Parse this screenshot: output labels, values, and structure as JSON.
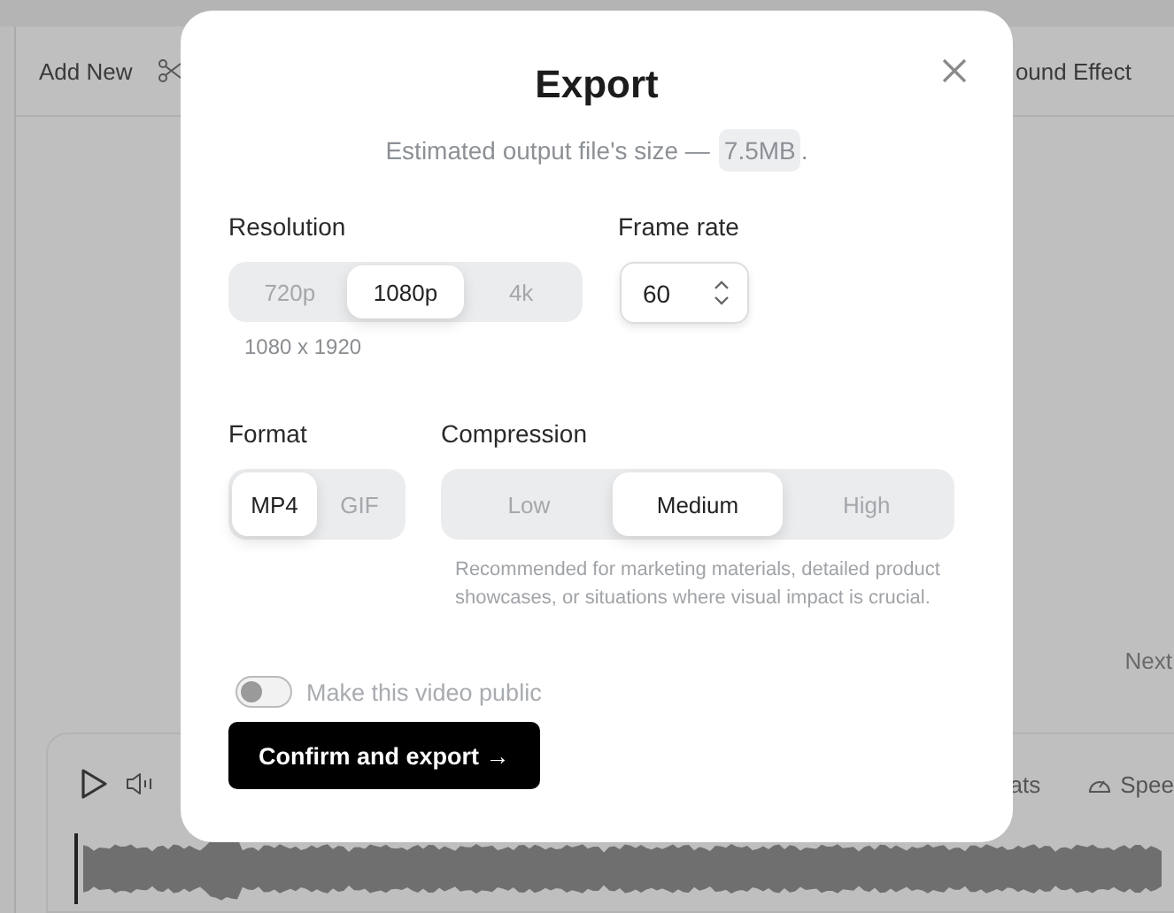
{
  "background": {
    "toolbar": {
      "add_new": "Add New",
      "sound_effect": "ound Effect"
    },
    "next": "Next",
    "player": {
      "beats": "ats",
      "speed": "Spee"
    }
  },
  "dialog": {
    "title": "Export",
    "subtitle": "Estimated output file's size —",
    "size": "7.5MB",
    "subtitle_end": ".",
    "resolution": {
      "label": "Resolution",
      "options": [
        {
          "label": "720p",
          "selected": false
        },
        {
          "label": "1080p",
          "selected": true
        },
        {
          "label": "4k",
          "selected": false
        }
      ],
      "caption": "1080 x 1920"
    },
    "frame_rate": {
      "label": "Frame rate",
      "value": "60"
    },
    "format": {
      "label": "Format",
      "options": [
        {
          "label": "MP4",
          "selected": true
        },
        {
          "label": "GIF",
          "selected": false
        }
      ]
    },
    "compression": {
      "label": "Compression",
      "options": [
        {
          "label": "Low",
          "selected": false
        },
        {
          "label": "Medium",
          "selected": true
        },
        {
          "label": "High",
          "selected": false
        }
      ],
      "description": "Recommended for marketing materials, detailed product showcases, or situations where visual impact is crucial."
    },
    "public_toggle": {
      "label": "Make this video public",
      "on": false
    },
    "confirm_button": "Confirm and export →"
  }
}
